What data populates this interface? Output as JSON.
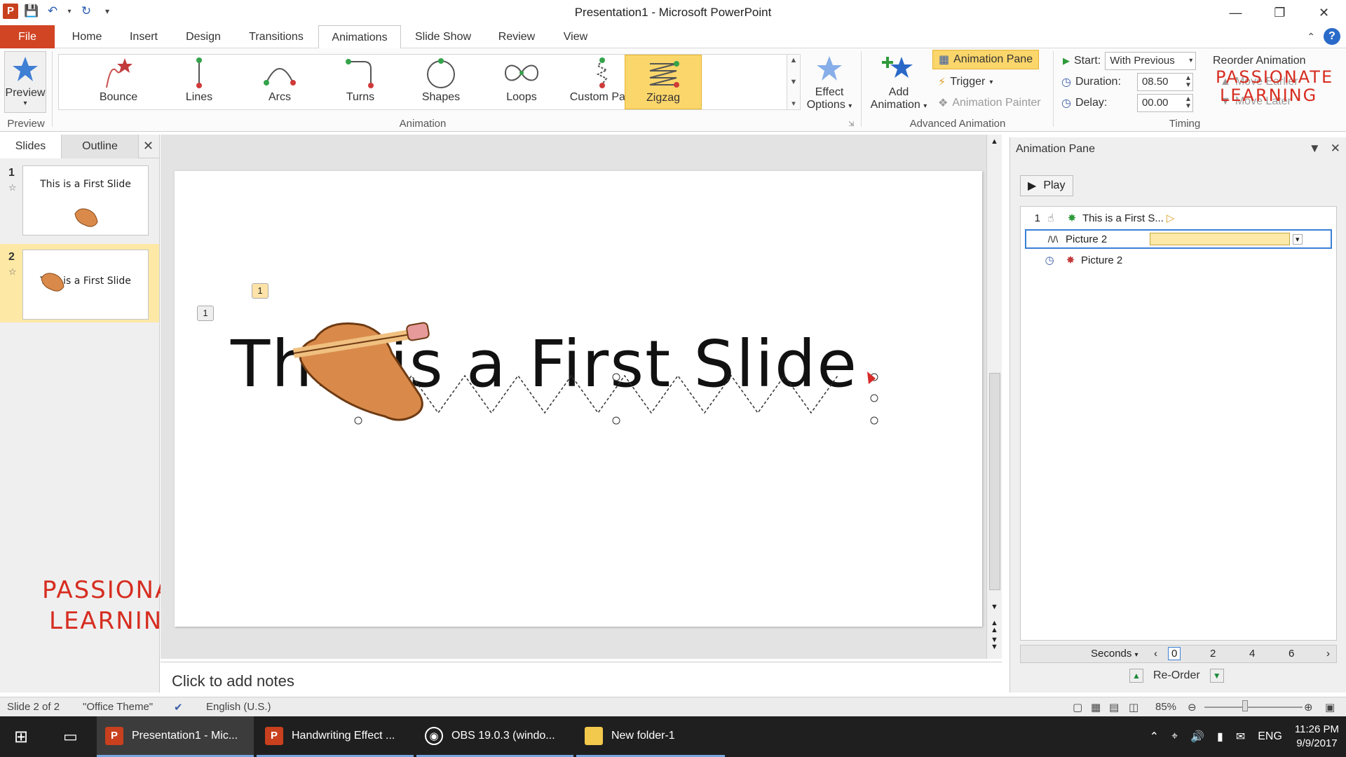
{
  "window": {
    "title": "Presentation1 - Microsoft PowerPoint"
  },
  "qat": {
    "app_icon": "powerpoint-icon",
    "app_letter": "P"
  },
  "ribbon_tabs": [
    "File",
    "Home",
    "Insert",
    "Design",
    "Transitions",
    "Animations",
    "Slide Show",
    "Review",
    "View"
  ],
  "ribbon": {
    "preview": {
      "label": "Preview",
      "group": "Preview"
    },
    "gallery": {
      "group": "Animation",
      "items": [
        "Bounce",
        "Lines",
        "Arcs",
        "Turns",
        "Shapes",
        "Loops",
        "Custom Path",
        "Zigzag"
      ],
      "selected": "Zigzag"
    },
    "effect_options": {
      "line1": "Effect",
      "line2": "Options"
    },
    "advanced": {
      "group": "Advanced Animation",
      "add_line1": "Add",
      "add_line2": "Animation",
      "animation_pane": "Animation Pane",
      "trigger": "Trigger",
      "painter": "Animation Painter"
    },
    "timing": {
      "group": "Timing",
      "start_label": "Start:",
      "start_value": "With Previous",
      "duration_label": "Duration:",
      "duration_value": "08.50",
      "delay_label": "Delay:",
      "delay_value": "00.00",
      "reorder_title": "Reorder Animation",
      "move_earlier": "Move Earlier",
      "move_later": "Move Later"
    }
  },
  "slides_panel": {
    "tab_slides": "Slides",
    "tab_outline": "Outline",
    "thumbs": [
      {
        "num": "1",
        "text": "This is a First Slide"
      },
      {
        "num": "2",
        "text": "This is a First Slide"
      }
    ]
  },
  "slide": {
    "title": "This is a First Slide",
    "tag_a": "1",
    "tag_b": "1"
  },
  "notes": {
    "placeholder": "Click to add notes"
  },
  "animation_pane": {
    "title": "Animation Pane",
    "play": "Play",
    "items": [
      {
        "index": "1",
        "name": "This is a First S..."
      },
      {
        "index": "",
        "name": "Picture 2"
      },
      {
        "index": "",
        "name": "Picture 2"
      }
    ],
    "timeline_unit": "Seconds",
    "ticks": [
      "0",
      "2",
      "4",
      "6"
    ],
    "reorder": "Re-Order"
  },
  "statusbar": {
    "slide": "Slide 2 of 2",
    "theme": "\"Office Theme\"",
    "language": "English (U.S.)",
    "zoom": "85%"
  },
  "taskbar": {
    "items": [
      {
        "label": "Presentation1 - Mic...",
        "icon": "powerpoint-icon"
      },
      {
        "label": "Handwriting Effect ...",
        "icon": "powerpoint-icon"
      },
      {
        "label": "OBS 19.0.3 (windo...",
        "icon": "obs-icon"
      },
      {
        "label": "New folder-1",
        "icon": "folder-icon"
      }
    ],
    "lang": "ENG",
    "time": "11:26 PM",
    "date": "9/9/2017"
  },
  "watermark": {
    "line1": "PASSIONATE",
    "line2": "LEARNING"
  },
  "colors": {
    "accent": "#d14424",
    "selected": "#fbd66b",
    "watermark": "#d62d20"
  }
}
